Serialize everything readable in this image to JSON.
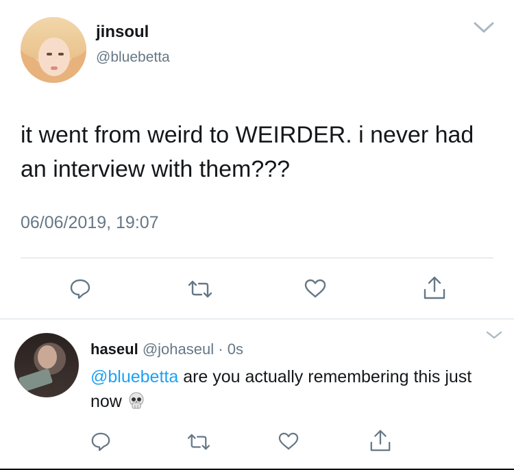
{
  "tweet": {
    "name": "jinsoul",
    "handle": "@bluebetta",
    "text": "it went from weird to WEIRDER. i never had an interview with them???",
    "timestamp": "06/06/2019, 19:07"
  },
  "reply": {
    "name": "haseul",
    "handle": "@johaseul",
    "separator": "·",
    "time": "0s",
    "mention": "@bluebetta",
    "text": " are you actually remembering this just now"
  },
  "icons": {
    "reply": "reply-icon",
    "retweet": "retweet-icon",
    "like": "heart-icon",
    "share": "share-icon",
    "more": "chevron-down-icon"
  },
  "colors": {
    "text": "#14171a",
    "secondary": "#657786",
    "link": "#1da1f2",
    "divider": "#d6dbe0"
  }
}
